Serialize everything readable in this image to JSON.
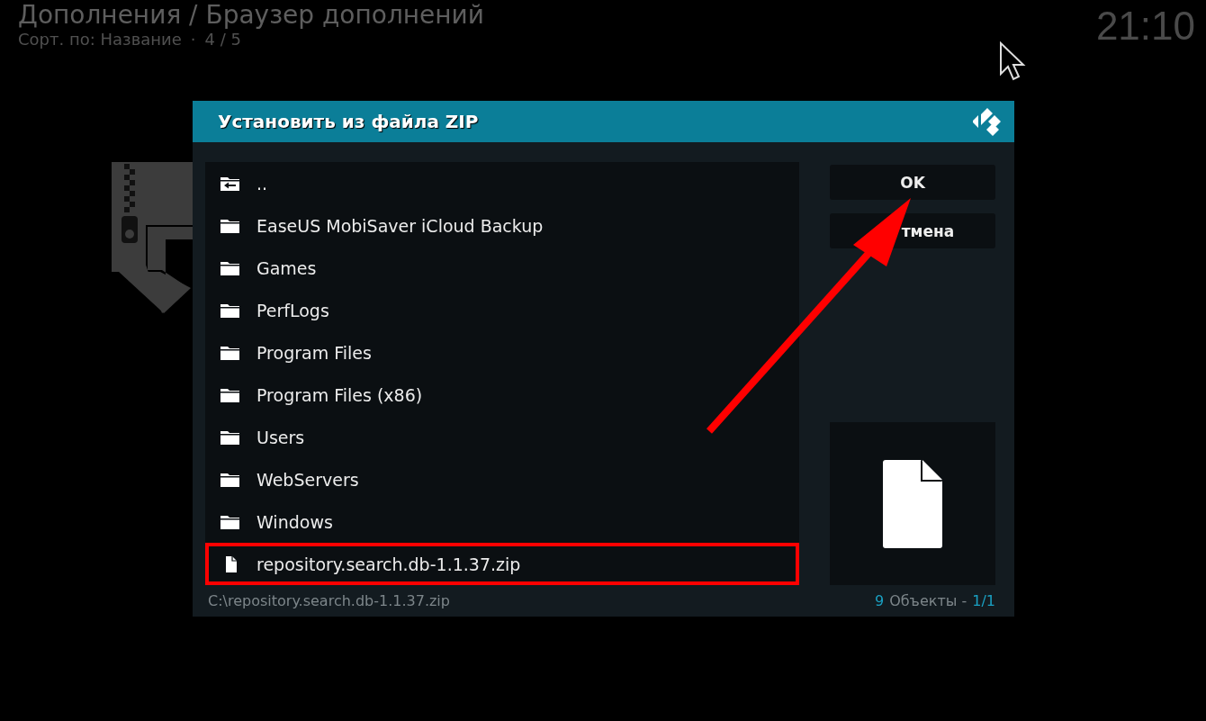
{
  "header": {
    "title": "Дополнения / Браузер дополнений",
    "sort": "Сорт. по: Название",
    "separator": "·",
    "page": "4 / 5",
    "clock": "21:10"
  },
  "dialog": {
    "title": "Установить из файла ZIP",
    "items": [
      {
        "kind": "parent",
        "label": "..",
        "outlined": false
      },
      {
        "kind": "folder",
        "label": "EaseUS MobiSaver iCloud Backup",
        "outlined": false
      },
      {
        "kind": "folder",
        "label": "Games",
        "outlined": false
      },
      {
        "kind": "folder",
        "label": "PerfLogs",
        "outlined": false
      },
      {
        "kind": "folder",
        "label": "Program Files",
        "outlined": false
      },
      {
        "kind": "folder",
        "label": "Program Files (x86)",
        "outlined": false
      },
      {
        "kind": "folder",
        "label": "Users",
        "outlined": false
      },
      {
        "kind": "folder",
        "label": "WebServers",
        "outlined": false
      },
      {
        "kind": "folder",
        "label": "Windows",
        "outlined": false
      },
      {
        "kind": "file",
        "label": "repository.search.db-1.1.37.zip",
        "outlined": true
      }
    ],
    "buttons": [
      {
        "label": "OK"
      },
      {
        "label": "тмена"
      }
    ],
    "path": "C:\\repository.search.db-1.1.37.zip",
    "count": "9",
    "count_label": "Объекты -",
    "page": "1/1"
  },
  "annotations": [
    {
      "kind": "arrow"
    }
  ]
}
